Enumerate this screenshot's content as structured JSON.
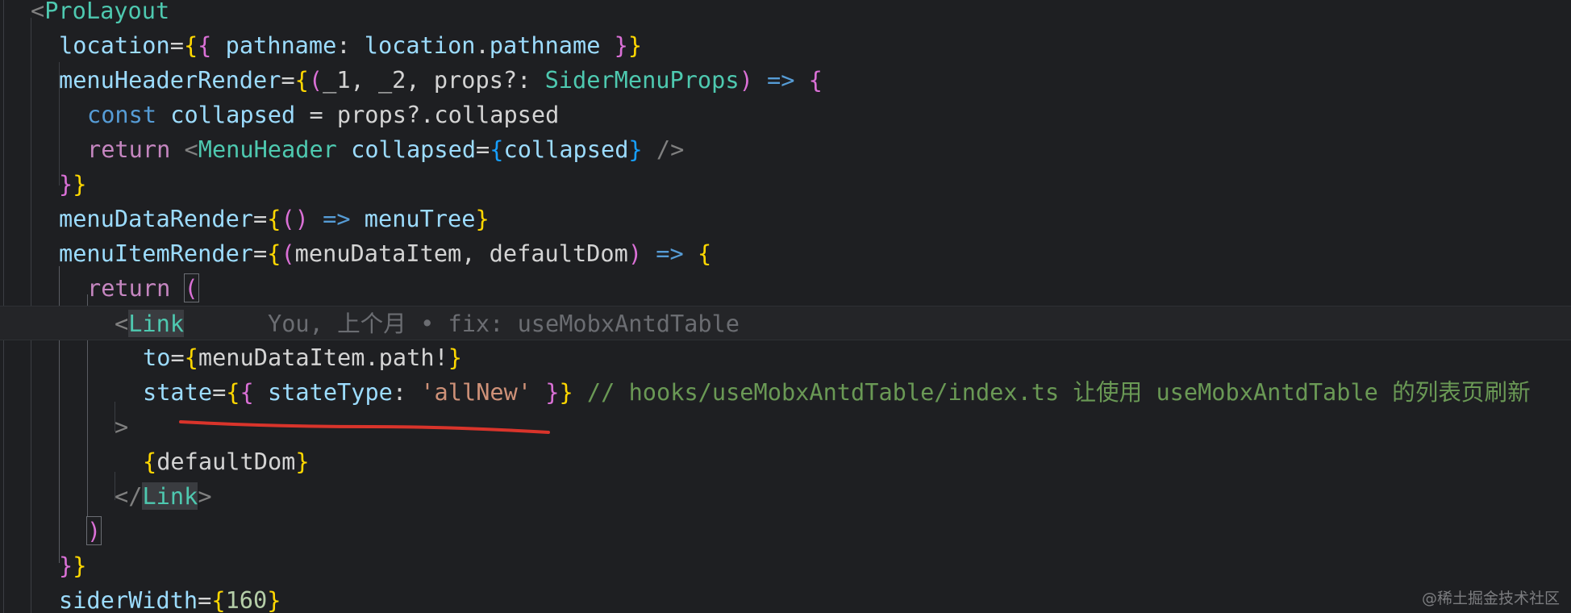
{
  "editor": {
    "lines": [
      [
        [
          "<",
          "punc"
        ],
        [
          "ProLayout",
          "tag"
        ]
      ],
      [
        [
          "location",
          "attr"
        ],
        [
          "=",
          "eq"
        ],
        [
          "{",
          "b1"
        ],
        [
          "{ ",
          "b2"
        ],
        [
          "pathname",
          "attr"
        ],
        [
          ": ",
          "plain"
        ],
        [
          "location",
          "var"
        ],
        [
          ".",
          "plain"
        ],
        [
          "pathname",
          "var"
        ],
        [
          " }",
          "b2"
        ],
        [
          "}",
          "b1"
        ]
      ],
      [
        [
          "menuHeaderRender",
          "attr"
        ],
        [
          "=",
          "eq"
        ],
        [
          "{",
          "b1"
        ],
        [
          "(",
          "b2"
        ],
        [
          "_1, _2, props?: ",
          "plain"
        ],
        [
          "SiderMenuProps",
          "type"
        ],
        [
          ")",
          "b2"
        ],
        [
          " => ",
          "kw"
        ],
        [
          "{",
          "b2"
        ]
      ],
      [
        [
          "const ",
          "kw"
        ],
        [
          "collapsed",
          "var"
        ],
        [
          " = props?.collapsed",
          "plain"
        ]
      ],
      [
        [
          "return ",
          "ctrl"
        ],
        [
          "<",
          "punc"
        ],
        [
          "MenuHeader ",
          "tag"
        ],
        [
          "collapsed",
          "attr"
        ],
        [
          "=",
          "eq"
        ],
        [
          "{",
          "b3"
        ],
        [
          "collapsed",
          "var"
        ],
        [
          "}",
          "b3"
        ],
        [
          " />",
          "punc"
        ]
      ],
      [
        [
          "}",
          "b2"
        ],
        [
          "}",
          "b1"
        ]
      ],
      [
        [
          "menuDataRender",
          "attr"
        ],
        [
          "=",
          "eq"
        ],
        [
          "{",
          "b1"
        ],
        [
          "()",
          "b2"
        ],
        [
          " => ",
          "kw"
        ],
        [
          "menuTree",
          "var"
        ],
        [
          "}",
          "b1"
        ]
      ],
      [
        [
          "menuItemRender",
          "attr"
        ],
        [
          "=",
          "eq"
        ],
        [
          "{",
          "b1"
        ],
        [
          "(",
          "b2"
        ],
        [
          "menuDataItem, defaultDom",
          "plain"
        ],
        [
          ")",
          "b2"
        ],
        [
          " => ",
          "kw"
        ],
        [
          "{",
          "b1"
        ]
      ],
      [
        [
          "return ",
          "ctrl"
        ],
        [
          "(",
          "b2"
        ]
      ],
      [
        [
          "<",
          "punc"
        ],
        [
          "Link",
          "tag"
        ]
      ],
      [
        [
          "to",
          "attr"
        ],
        [
          "=",
          "eq"
        ],
        [
          "{",
          "b1"
        ],
        [
          "menuDataItem.path!",
          "plain"
        ],
        [
          "}",
          "b1"
        ]
      ],
      [
        [
          "state",
          "attr"
        ],
        [
          "=",
          "eq"
        ],
        [
          "{",
          "b1"
        ],
        [
          "{ ",
          "b2"
        ],
        [
          "stateType",
          "attr"
        ],
        [
          ": ",
          "plain"
        ],
        [
          "'allNew'",
          "str"
        ],
        [
          " }",
          "b2"
        ],
        [
          "}",
          "b1"
        ],
        [
          " // hooks/useMobxAntdTable/index.ts 让使用 useMobxAntdTable 的列表页刷新",
          "com"
        ]
      ],
      [
        [
          ">",
          "punc"
        ]
      ],
      [
        [
          "{",
          "b1"
        ],
        [
          "defaultDom",
          "plain"
        ],
        [
          "}",
          "b1"
        ]
      ],
      [
        [
          "</",
          "punc"
        ],
        [
          "Link",
          "tag"
        ],
        [
          ">",
          "punc"
        ]
      ],
      [
        [
          ")",
          "b2"
        ]
      ],
      [
        [
          "}",
          "b2"
        ],
        [
          "}",
          "b1"
        ]
      ],
      [
        [
          "siderWidth",
          "attr"
        ],
        [
          "=",
          "eq"
        ],
        [
          "{",
          "b1"
        ],
        [
          "160",
          "num"
        ],
        [
          "}",
          "b1"
        ]
      ]
    ],
    "blame": "You, 上个月 • fix: useMobxAntdTable",
    "underline_color": "#d9342b"
  },
  "watermark": "@稀土掘金技术社区"
}
